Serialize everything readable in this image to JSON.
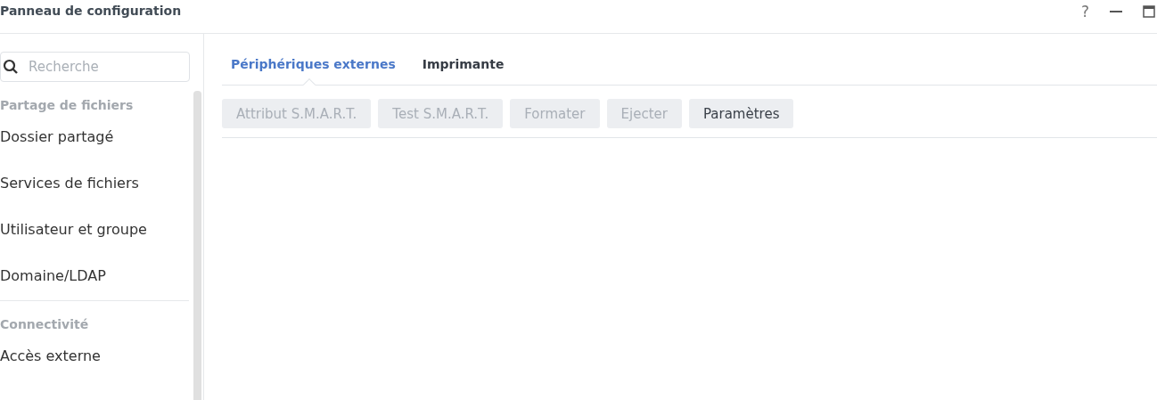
{
  "window": {
    "title": "Panneau de configuration",
    "help": "?"
  },
  "sidebar": {
    "search": {
      "placeholder": "Recherche"
    },
    "sections": [
      {
        "title": "Partage de fichiers",
        "items": [
          {
            "label": "Dossier partagé",
            "selected": false
          },
          {
            "label": "Services de fichiers",
            "selected": false
          },
          {
            "label": "Utilisateur et groupe",
            "selected": false
          },
          {
            "label": "Domaine/LDAP",
            "selected": false
          }
        ]
      },
      {
        "title": "Connectivité",
        "items": [
          {
            "label": "Accès externe",
            "selected": false
          }
        ]
      }
    ]
  },
  "tabs": [
    {
      "label": "Périphériques externes",
      "selected": true
    },
    {
      "label": "Imprimante",
      "selected": false
    }
  ],
  "toolbar": [
    {
      "label": "Attribut S.M.A.R.T.",
      "disabled": true
    },
    {
      "label": "Test S.M.A.R.T.",
      "disabled": true
    },
    {
      "label": "Formater",
      "disabled": true
    },
    {
      "label": "Ejecter",
      "disabled": true
    },
    {
      "label": "Paramètres",
      "disabled": false
    }
  ]
}
